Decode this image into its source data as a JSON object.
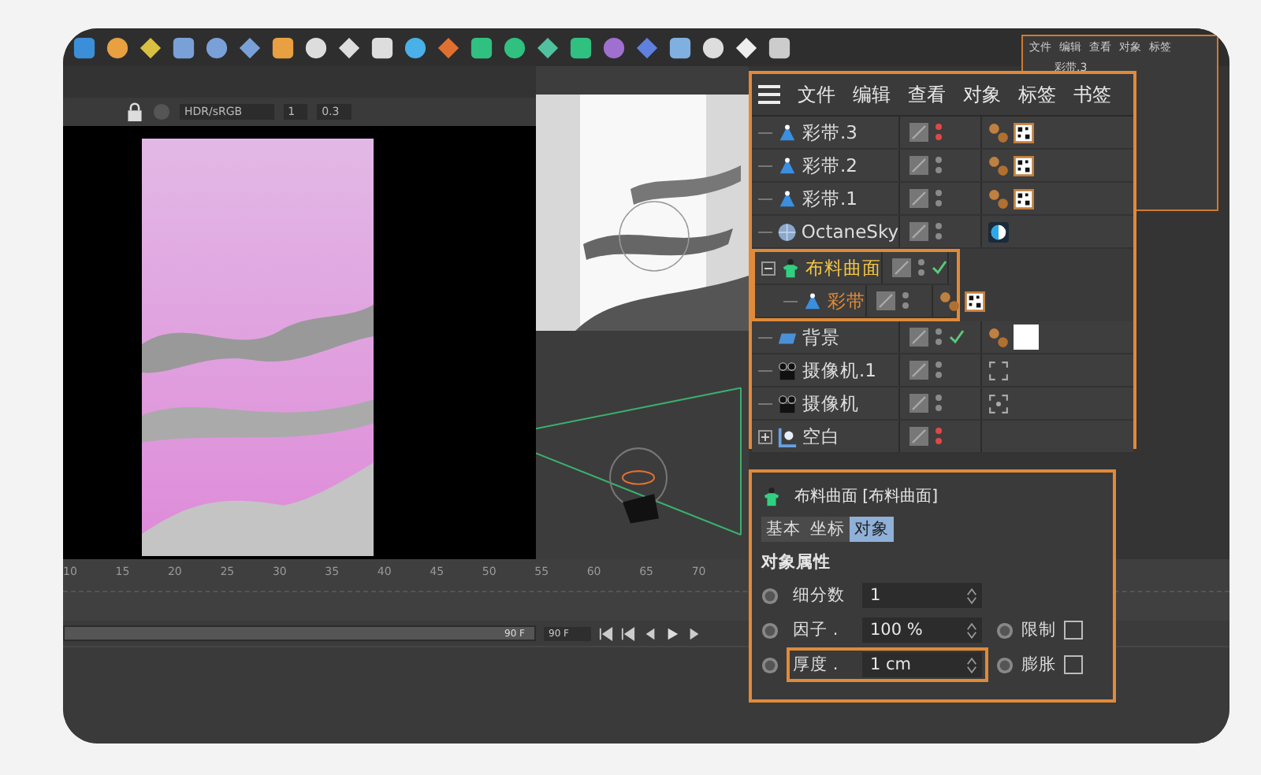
{
  "viewport": {
    "display_mode": "HDR/sRGB",
    "value_1": "1",
    "value_2": "0.3"
  },
  "object_manager": {
    "menu": [
      "文件",
      "编辑",
      "查看",
      "对象",
      "标签",
      "书签"
    ],
    "objects": [
      {
        "name": "彩带.3",
        "kind": "cone",
        "hidden": true,
        "check": false,
        "selected": false,
        "tags": [
          {
            "kind": "material"
          },
          {
            "kind": "checker"
          }
        ]
      },
      {
        "name": "彩带.2",
        "kind": "cone",
        "hidden": false,
        "check": false,
        "selected": false,
        "tags": [
          {
            "kind": "material"
          },
          {
            "kind": "checker"
          }
        ]
      },
      {
        "name": "彩带.1",
        "kind": "cone",
        "hidden": false,
        "check": false,
        "selected": false,
        "tags": [
          {
            "kind": "material"
          },
          {
            "kind": "checker"
          }
        ]
      },
      {
        "name": "OctaneSky",
        "kind": "sky",
        "hidden": false,
        "check": false,
        "selected": false,
        "tags": [
          {
            "kind": "sky"
          }
        ]
      },
      {
        "name": "布料曲面",
        "kind": "cloth",
        "hidden": false,
        "check": true,
        "selected": true,
        "outlined": true,
        "expanded": true,
        "children": [
          {
            "name": "彩带",
            "kind": "cone",
            "hidden": false,
            "check": false,
            "selected": true,
            "tags": [
              {
                "kind": "material"
              },
              {
                "kind": "checker"
              }
            ]
          }
        ]
      },
      {
        "name": "背景",
        "kind": "background",
        "hidden": false,
        "check": true,
        "selected": false,
        "tags": [
          {
            "kind": "material"
          },
          {
            "kind": "blank"
          }
        ]
      },
      {
        "name": "摄像机.1",
        "kind": "camera",
        "hidden": false,
        "check": false,
        "selected": false,
        "tags": [
          {
            "kind": "target"
          }
        ]
      },
      {
        "name": "摄像机",
        "kind": "camera",
        "hidden": false,
        "check": false,
        "selected": false,
        "tags": [
          {
            "kind": "focus"
          }
        ]
      },
      {
        "name": "空白",
        "kind": "null",
        "hidden": true,
        "check": false,
        "selected": false,
        "expanded": false
      }
    ]
  },
  "mini_panel": {
    "menu": [
      "文件",
      "编辑",
      "查看",
      "对象",
      "标签"
    ],
    "first_item": "彩带.3"
  },
  "attributes": {
    "title": "布料曲面 [布料曲面]",
    "tabs": [
      {
        "label": "基本",
        "selected": false
      },
      {
        "label": "坐标",
        "selected": false
      },
      {
        "label": "对象",
        "selected": true
      }
    ],
    "section": "对象属性",
    "rows": [
      {
        "label": "细分数",
        "value": "1",
        "outlined": false
      },
      {
        "label": "因子 .",
        "value": "100 %",
        "outlined": false,
        "option": {
          "label": "限制",
          "checked": false
        }
      },
      {
        "label": "厚度 .",
        "value": "1 cm",
        "outlined": true,
        "option": {
          "label": "膨胀",
          "checked": false
        }
      }
    ]
  },
  "timeline": {
    "ticks": [
      "10",
      "15",
      "20",
      "25",
      "30",
      "35",
      "40",
      "45",
      "50",
      "55",
      "60",
      "65",
      "70"
    ],
    "range": {
      "level": 1,
      "end_label": "90 F"
    },
    "max_frame": "90 F"
  }
}
